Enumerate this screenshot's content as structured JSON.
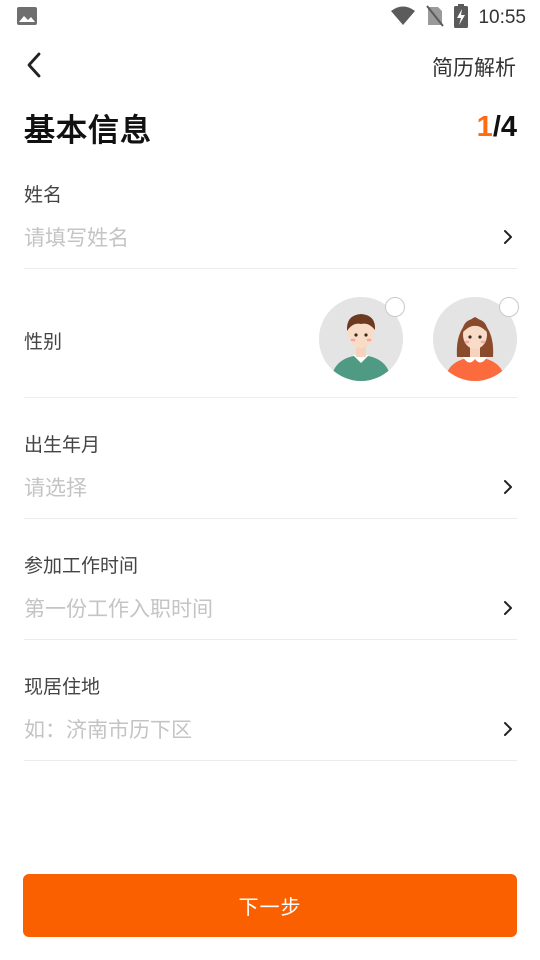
{
  "status_bar": {
    "time": "10:55",
    "icons": [
      "image-icon",
      "wifi-icon",
      "no-sim-icon",
      "battery-charging-icon"
    ]
  },
  "top_bar": {
    "back_icon": "back-arrow-icon",
    "right_link": "简历解析"
  },
  "header": {
    "title": "基本信息",
    "step_current": "1",
    "step_total": "/4"
  },
  "form": {
    "name": {
      "label": "姓名",
      "placeholder": "请填写姓名"
    },
    "gender": {
      "label": "性别",
      "options": [
        "male-avatar",
        "female-avatar"
      ]
    },
    "birth": {
      "label": "出生年月",
      "placeholder": "请选择"
    },
    "work_start": {
      "label": "参加工作时间",
      "placeholder": "第一份工作入职时间"
    },
    "residence": {
      "label": "现居住地",
      "placeholder": "如：济南市历下区"
    }
  },
  "next_button": {
    "label": "下一步"
  },
  "colors": {
    "accent": "#fb6000",
    "step_accent": "#ff6a13",
    "divider": "#ececec",
    "placeholder": "#c4c4c4"
  }
}
